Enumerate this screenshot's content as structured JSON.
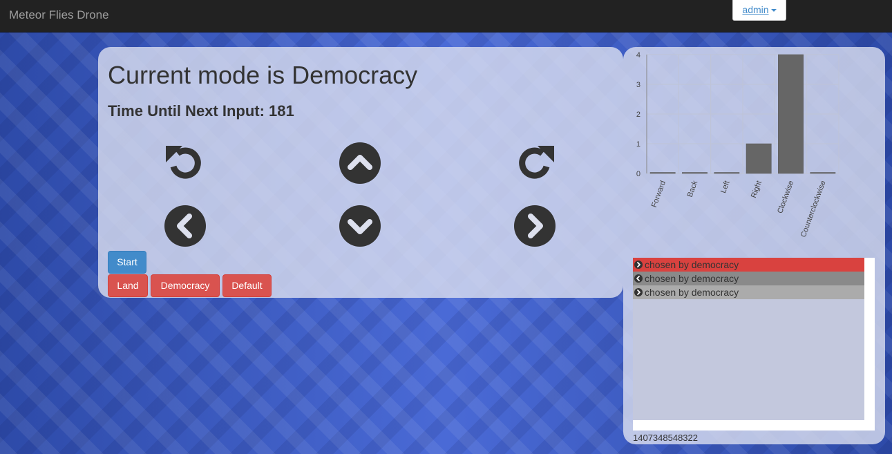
{
  "navbar": {
    "brand": "Meteor Flies Drone",
    "user": "admin"
  },
  "control_panel": {
    "mode_title": "Current mode is Democracy",
    "timer_text": "Time Until Next Input: 181",
    "controls": [
      {
        "name": "rotate-counterclockwise",
        "icon": "undo-icon"
      },
      {
        "name": "forward",
        "icon": "chevron-circle-up-icon"
      },
      {
        "name": "rotate-clockwise",
        "icon": "redo-icon"
      },
      {
        "name": "left",
        "icon": "chevron-circle-left-icon"
      },
      {
        "name": "back",
        "icon": "chevron-circle-down-icon"
      },
      {
        "name": "right",
        "icon": "chevron-circle-right-icon"
      }
    ],
    "buttons": {
      "start": "Start",
      "land": "Land",
      "democracy": "Democracy",
      "default": "Default"
    },
    "colors": {
      "primary": "#428bca",
      "danger": "#d9534f",
      "icon": "#333333"
    }
  },
  "chart_data": {
    "type": "bar",
    "categories": [
      "Forward",
      "Back",
      "Left",
      "Right",
      "Clockwise",
      "Counterclockwise"
    ],
    "values": [
      0,
      0,
      0,
      1,
      4,
      0
    ],
    "ylim": [
      0,
      4
    ],
    "yticks": [
      0,
      1,
      2,
      3,
      4
    ],
    "grid": true,
    "bar_color": "#666666"
  },
  "log": {
    "entries": [
      {
        "text": "chosen by democracy",
        "icon": "chevron-circle-right-icon",
        "bg": "#d9423f"
      },
      {
        "text": "chosen by democracy",
        "icon": "chevron-circle-left-icon",
        "bg": "#8a8a8a"
      },
      {
        "text": "chosen by democracy",
        "icon": "chevron-circle-right-icon",
        "bg": "#ababab"
      }
    ]
  },
  "timestamp": "1407348548322"
}
